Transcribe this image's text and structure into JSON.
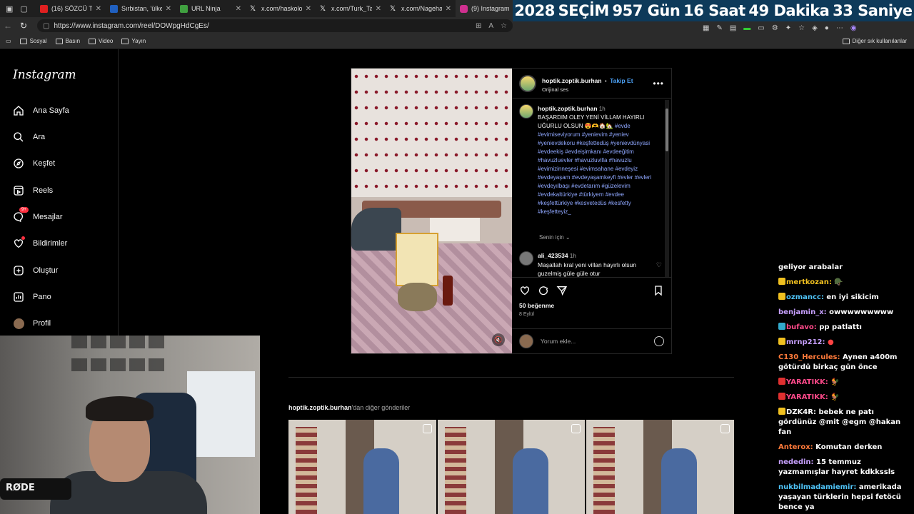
{
  "browser": {
    "tabs": [
      {
        "label": "(16) SÖZCÜ TV",
        "color": "#e02020"
      },
      {
        "label": "Sırbistan, 'ülkem",
        "color": "#2060c0"
      },
      {
        "label": "URL Ninja",
        "color": "#40a040"
      },
      {
        "label": "x.com/haskolog",
        "color": "#ffffff"
      },
      {
        "label": "x.com/Turk_Tar",
        "color": "#ffffff"
      },
      {
        "label": "x.com/Nagehan",
        "color": "#ffffff"
      },
      {
        "label": "(9) Instagram",
        "color": "#d03090"
      }
    ],
    "url": "https://www.instagram.com/reel/DOWpgHdCgEs/",
    "bookmarks": [
      "Sosyal",
      "Basın",
      "Video",
      "Yayın"
    ],
    "bookmarks_right": "Diğer sık kullanılanlar"
  },
  "countdown": {
    "year": "2028",
    "label": "SEÇİM",
    "days": "957 Gün",
    "hours": "16 Saat",
    "minutes": "49 Dakika",
    "seconds": "33 Saniye"
  },
  "sidebar": {
    "logo": "Instagram",
    "items": [
      {
        "label": "Ana Sayfa",
        "icon": "home-icon"
      },
      {
        "label": "Ara",
        "icon": "search-icon"
      },
      {
        "label": "Keşfet",
        "icon": "compass-icon"
      },
      {
        "label": "Reels",
        "icon": "reels-icon"
      },
      {
        "label": "Mesajlar",
        "icon": "messenger-icon",
        "badge": "9+"
      },
      {
        "label": "Bildirimler",
        "icon": "heart-icon"
      },
      {
        "label": "Oluştur",
        "icon": "plus-icon"
      },
      {
        "label": "Pano",
        "icon": "dashboard-icon"
      },
      {
        "label": "Profil",
        "icon": "avatar-icon"
      }
    ]
  },
  "post": {
    "username": "hoptik.zoptik.burhan",
    "follow": "Takip Et",
    "audio": "Orijinal ses",
    "caption_time": "1h",
    "caption_text": "BAŞARDIM OLEY YENİ VİLLAM HAYIRLI UĞURLU OLSUN 😍🫶🏠🏡",
    "caption_tags": "#evde #evimiseviyorum #yenievim #yeniev #yenievdekoru #keşfettedüş #yenievdünyasi #evdeekiş #evdeişimkanı #evdeeğitim #havuzluevler #havuzluvilla #havuzlu #evimizinneşesi #evimsahane #evdeyiz #evdeyaşam #evdeyaşamkeyfi #evler #evleri #evdeyılbaşı #evdetarım #güzelevim #evdekaltürkiye #türkiyem #evdee #keşfettürkiye #kesvetedüs #kesfetty #keşfetteyiz_",
    "senin_icin": "Senin için",
    "comment_user": "ali_423534",
    "comment_time": "1h",
    "comment_text": "Maşallah kral yeni villan hayırlı olsun guzelmiş güle güle otur",
    "likes": "50 beğenme",
    "date": "8 Eylül",
    "add_comment_placeholder": "Yorum ekle..."
  },
  "more_posts": {
    "user": "hoptik.zoptik.burhan",
    "suffix": "'dan diğer gönderiler"
  },
  "webcam": {
    "mic_brand": "RØDE"
  },
  "chat": [
    {
      "user": "",
      "text": "geliyor arabalar",
      "color": "#ffffff"
    },
    {
      "user": "mertkozan:",
      "text": "",
      "color": "#f0c020"
    },
    {
      "user": "ozmancc:",
      "text": "en iyi sikicim",
      "color": "#4fc3f7"
    },
    {
      "user": "benjamin_x:",
      "text": "owwwwwwwww",
      "color": "#c7a0ff"
    },
    {
      "user": "bufavo:",
      "text": "pp patlattı",
      "color": "#ff4a8a"
    },
    {
      "user": "mrnp212:",
      "text": "",
      "color": "#c7a0ff"
    },
    {
      "user": "C130_Hercules:",
      "text": "Aynen a400m götürdü birkaç gün önce",
      "color": "#ff7a3a"
    },
    {
      "user": "YARATIKK:",
      "text": "",
      "color": "#ff4a8a"
    },
    {
      "user": "YARATIKK:",
      "text": "",
      "color": "#ff4a8a"
    },
    {
      "user": "DZK4R:",
      "text": "bebek ne patı gördünüz @mit @egm @hakan fan",
      "color": "#ffffff"
    },
    {
      "user": "Anterox:",
      "text": "Komutan derken",
      "color": "#ff7a3a"
    },
    {
      "user": "nededin:",
      "text": "15 temmuz yazmamışlar hayret kdkkssls",
      "color": "#c7a0ff"
    },
    {
      "user": "nukbilmadamiemir:",
      "text": "amerikada yaşayan türklerin hepsi fetöcü bence ya",
      "color": "#4fc3f7"
    }
  ]
}
